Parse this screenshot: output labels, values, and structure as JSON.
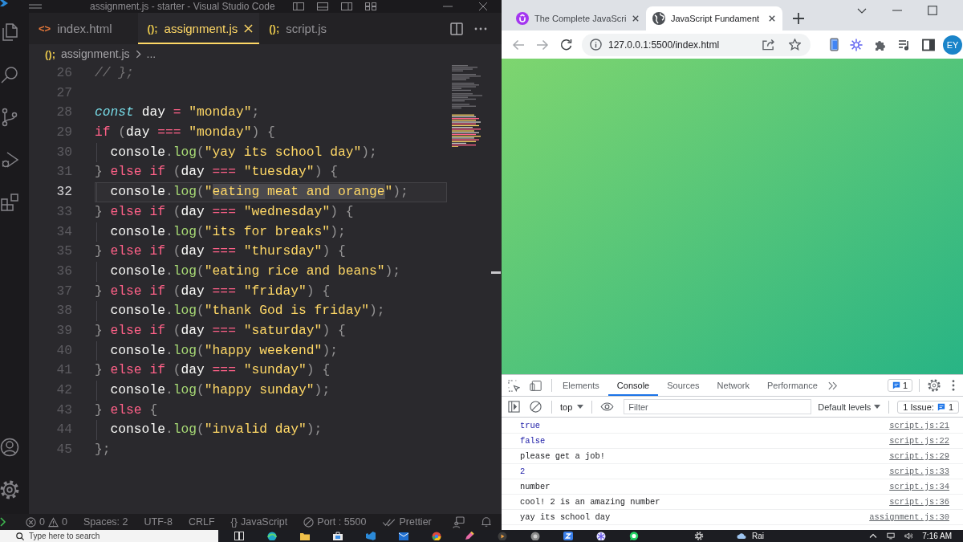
{
  "vscode": {
    "title": "assignment.js - starter - Visual Studio Code",
    "tabs": [
      {
        "icon": "<>",
        "label": "index.html",
        "kind": "html",
        "selected": false
      },
      {
        "icon": "();",
        "label": "assignment.js",
        "kind": "js",
        "selected": true
      },
      {
        "icon": "();",
        "label": "script.js",
        "kind": "js",
        "selected": false
      }
    ],
    "breadcrumb": {
      "icon": "();",
      "kind": "js",
      "file": "assignment.js",
      "rest": "..."
    },
    "lines": [
      {
        "number": "26",
        "current": false,
        "indent_guide": false,
        "tokens": [
          {
            "text": "// };",
            "kind": "comment"
          }
        ]
      },
      {
        "number": "27",
        "current": false,
        "indent_guide": false
      },
      {
        "number": "28",
        "current": false,
        "indent_guide": false,
        "tokens": [
          {
            "text": "const",
            "kind": "storage"
          },
          {
            "text": " day ",
            "kind": "variable"
          },
          {
            "text": "=",
            "kind": "operator"
          },
          {
            "text": " \"monday\"",
            "kind": "string"
          },
          {
            "text": ";",
            "kind": "punct"
          }
        ]
      },
      {
        "number": "29",
        "current": false,
        "indent_guide": false,
        "tokens": [
          {
            "text": "if",
            "kind": "keyword"
          },
          {
            "text": " (",
            "kind": "punct"
          },
          {
            "text": "day ",
            "kind": "variable"
          },
          {
            "text": "===",
            "kind": "operator"
          },
          {
            "text": " \"monday\"",
            "kind": "string"
          },
          {
            "text": ") {",
            "kind": "punct"
          }
        ]
      },
      {
        "number": "30",
        "current": false,
        "indent_guide": true,
        "tokens": [
          {
            "text": "  console",
            "kind": "variable"
          },
          {
            "text": ".",
            "kind": "punct"
          },
          {
            "text": "log",
            "kind": "function"
          },
          {
            "text": "(",
            "kind": "punct"
          },
          {
            "text": "\"yay its school day\"",
            "kind": "string"
          },
          {
            "text": ");",
            "kind": "punct"
          }
        ]
      },
      {
        "number": "31",
        "current": false,
        "indent_guide": false,
        "tokens": [
          {
            "text": "} ",
            "kind": "punct"
          },
          {
            "text": "else if",
            "kind": "keyword"
          },
          {
            "text": " (",
            "kind": "punct"
          },
          {
            "text": "day ",
            "kind": "variable"
          },
          {
            "text": "===",
            "kind": "operator"
          },
          {
            "text": " \"tuesday\"",
            "kind": "string"
          },
          {
            "text": ") {",
            "kind": "punct"
          }
        ]
      },
      {
        "number": "32",
        "current": true,
        "indent_guide": true,
        "tokens": [
          {
            "text": "  console",
            "kind": "variable"
          },
          {
            "text": ".",
            "kind": "punct"
          },
          {
            "text": "log",
            "kind": "function"
          },
          {
            "text": "(",
            "kind": "punct"
          },
          {
            "text": "\"",
            "kind": "string"
          },
          {
            "text": "eating meat and orange",
            "kind": "selection"
          },
          {
            "text": "\"",
            "kind": "string"
          },
          {
            "text": ");",
            "kind": "punct"
          }
        ]
      },
      {
        "number": "33",
        "current": false,
        "indent_guide": false,
        "tokens": [
          {
            "text": "} ",
            "kind": "punct"
          },
          {
            "text": "else if",
            "kind": "keyword"
          },
          {
            "text": " (",
            "kind": "punct"
          },
          {
            "text": "day ",
            "kind": "variable"
          },
          {
            "text": "===",
            "kind": "operator"
          },
          {
            "text": " \"wednesday\"",
            "kind": "string"
          },
          {
            "text": ") {",
            "kind": "punct"
          }
        ]
      },
      {
        "number": "34",
        "current": false,
        "indent_guide": true,
        "tokens": [
          {
            "text": "  console",
            "kind": "variable"
          },
          {
            "text": ".",
            "kind": "punct"
          },
          {
            "text": "log",
            "kind": "function"
          },
          {
            "text": "(",
            "kind": "punct"
          },
          {
            "text": "\"its for breaks\"",
            "kind": "string"
          },
          {
            "text": ");",
            "kind": "punct"
          }
        ]
      },
      {
        "number": "35",
        "current": false,
        "indent_guide": false,
        "tokens": [
          {
            "text": "} ",
            "kind": "punct"
          },
          {
            "text": "else if",
            "kind": "keyword"
          },
          {
            "text": " (",
            "kind": "punct"
          },
          {
            "text": "day ",
            "kind": "variable"
          },
          {
            "text": "===",
            "kind": "operator"
          },
          {
            "text": " \"thursday\"",
            "kind": "string"
          },
          {
            "text": ") {",
            "kind": "punct"
          }
        ]
      },
      {
        "number": "36",
        "current": false,
        "indent_guide": true,
        "tokens": [
          {
            "text": "  console",
            "kind": "variable"
          },
          {
            "text": ".",
            "kind": "punct"
          },
          {
            "text": "log",
            "kind": "function"
          },
          {
            "text": "(",
            "kind": "punct"
          },
          {
            "text": "\"eating rice and beans\"",
            "kind": "string"
          },
          {
            "text": ");",
            "kind": "punct"
          }
        ]
      },
      {
        "number": "37",
        "current": false,
        "indent_guide": false,
        "tokens": [
          {
            "text": "} ",
            "kind": "punct"
          },
          {
            "text": "else if",
            "kind": "keyword"
          },
          {
            "text": " (",
            "kind": "punct"
          },
          {
            "text": "day ",
            "kind": "variable"
          },
          {
            "text": "===",
            "kind": "operator"
          },
          {
            "text": " \"friday\"",
            "kind": "string"
          },
          {
            "text": ") {",
            "kind": "punct"
          }
        ]
      },
      {
        "number": "38",
        "current": false,
        "indent_guide": true,
        "tokens": [
          {
            "text": "  console",
            "kind": "variable"
          },
          {
            "text": ".",
            "kind": "punct"
          },
          {
            "text": "log",
            "kind": "function"
          },
          {
            "text": "(",
            "kind": "punct"
          },
          {
            "text": "\"thank God is friday\"",
            "kind": "string"
          },
          {
            "text": ");",
            "kind": "punct"
          }
        ]
      },
      {
        "number": "39",
        "current": false,
        "indent_guide": false,
        "tokens": [
          {
            "text": "} ",
            "kind": "punct"
          },
          {
            "text": "else if",
            "kind": "keyword"
          },
          {
            "text": " (",
            "kind": "punct"
          },
          {
            "text": "day ",
            "kind": "variable"
          },
          {
            "text": "===",
            "kind": "operator"
          },
          {
            "text": " \"saturday\"",
            "kind": "string"
          },
          {
            "text": ") {",
            "kind": "punct"
          }
        ]
      },
      {
        "number": "40",
        "current": false,
        "indent_guide": true,
        "tokens": [
          {
            "text": "  console",
            "kind": "variable"
          },
          {
            "text": ".",
            "kind": "punct"
          },
          {
            "text": "log",
            "kind": "function"
          },
          {
            "text": "(",
            "kind": "punct"
          },
          {
            "text": "\"happy weekend\"",
            "kind": "string"
          },
          {
            "text": ");",
            "kind": "punct"
          }
        ]
      },
      {
        "number": "41",
        "current": false,
        "indent_guide": false,
        "tokens": [
          {
            "text": "} ",
            "kind": "punct"
          },
          {
            "text": "else if",
            "kind": "keyword"
          },
          {
            "text": " (",
            "kind": "punct"
          },
          {
            "text": "day ",
            "kind": "variable"
          },
          {
            "text": "===",
            "kind": "operator"
          },
          {
            "text": " \"sunday\"",
            "kind": "string"
          },
          {
            "text": ") {",
            "kind": "punct"
          }
        ]
      },
      {
        "number": "42",
        "current": false,
        "indent_guide": true,
        "tokens": [
          {
            "text": "  console",
            "kind": "variable"
          },
          {
            "text": ".",
            "kind": "punct"
          },
          {
            "text": "log",
            "kind": "function"
          },
          {
            "text": "(",
            "kind": "punct"
          },
          {
            "text": "\"happy sunday\"",
            "kind": "string"
          },
          {
            "text": ");",
            "kind": "punct"
          }
        ]
      },
      {
        "number": "43",
        "current": false,
        "indent_guide": false,
        "tokens": [
          {
            "text": "} ",
            "kind": "punct"
          },
          {
            "text": "else",
            "kind": "keyword"
          },
          {
            "text": " {",
            "kind": "punct"
          }
        ]
      },
      {
        "number": "44",
        "current": false,
        "indent_guide": true,
        "tokens": [
          {
            "text": "  console",
            "kind": "variable"
          },
          {
            "text": ".",
            "kind": "punct"
          },
          {
            "text": "log",
            "kind": "function"
          },
          {
            "text": "(",
            "kind": "punct"
          },
          {
            "text": "\"invalid day\"",
            "kind": "string"
          },
          {
            "text": ");",
            "kind": "punct"
          }
        ]
      },
      {
        "number": "45",
        "current": false,
        "indent_guide": false,
        "tokens": [
          {
            "text": "};",
            "kind": "punct"
          }
        ]
      }
    ],
    "status_bar": {
      "errors": "0",
      "warnings": "0",
      "items": [
        {
          "label": "Spaces: 2",
          "kind": "text"
        },
        {
          "label": "UTF-8",
          "kind": "text"
        },
        {
          "label": "CRLF",
          "kind": "text"
        },
        {
          "icon": "{}",
          "label": "JavaScript",
          "kind": "language"
        },
        {
          "label": "Port : 5500",
          "kind": "port"
        },
        {
          "label": "Prettier",
          "kind": "formatter"
        }
      ]
    }
  },
  "browser": {
    "tabs": [
      {
        "title": "The Complete JavaScri",
        "kind": "course",
        "selected": false
      },
      {
        "title": "JavaScript Fundament",
        "kind": "web",
        "selected": true
      }
    ],
    "url": "127.0.0.1:5500/index.html",
    "avatar": "EY"
  },
  "devtools": {
    "tabs": [
      {
        "label": "Elements",
        "selected": false
      },
      {
        "label": "Console",
        "selected": true
      },
      {
        "label": "Sources",
        "selected": false
      },
      {
        "label": "Network",
        "selected": false
      },
      {
        "label": "Performance",
        "selected": false
      }
    ],
    "issues_badge": "1",
    "context": "top",
    "filter": {
      "placeholder": "Filter"
    },
    "levels": "Default levels",
    "issues_label": "1 Issue:",
    "issues_count": "1",
    "messages": [
      {
        "text": "true",
        "kind": "value",
        "source": "script.js:21"
      },
      {
        "text": "false",
        "kind": "value",
        "source": "script.js:22"
      },
      {
        "text": "please get a job!",
        "kind": "text",
        "source": "script.js:29"
      },
      {
        "text": "2",
        "kind": "value",
        "source": "script.js:33"
      },
      {
        "text": "number",
        "kind": "text",
        "source": "script.js:34"
      },
      {
        "text": "cool! 2 is an amazing number",
        "kind": "text",
        "source": "script.js:36"
      },
      {
        "text": "yay its school day",
        "kind": "text",
        "source": "assignment.js:30"
      }
    ]
  },
  "taskbar": {
    "search": {
      "placeholder": "Type here to search"
    },
    "weather": "Rai",
    "time": "7:16 AM"
  }
}
